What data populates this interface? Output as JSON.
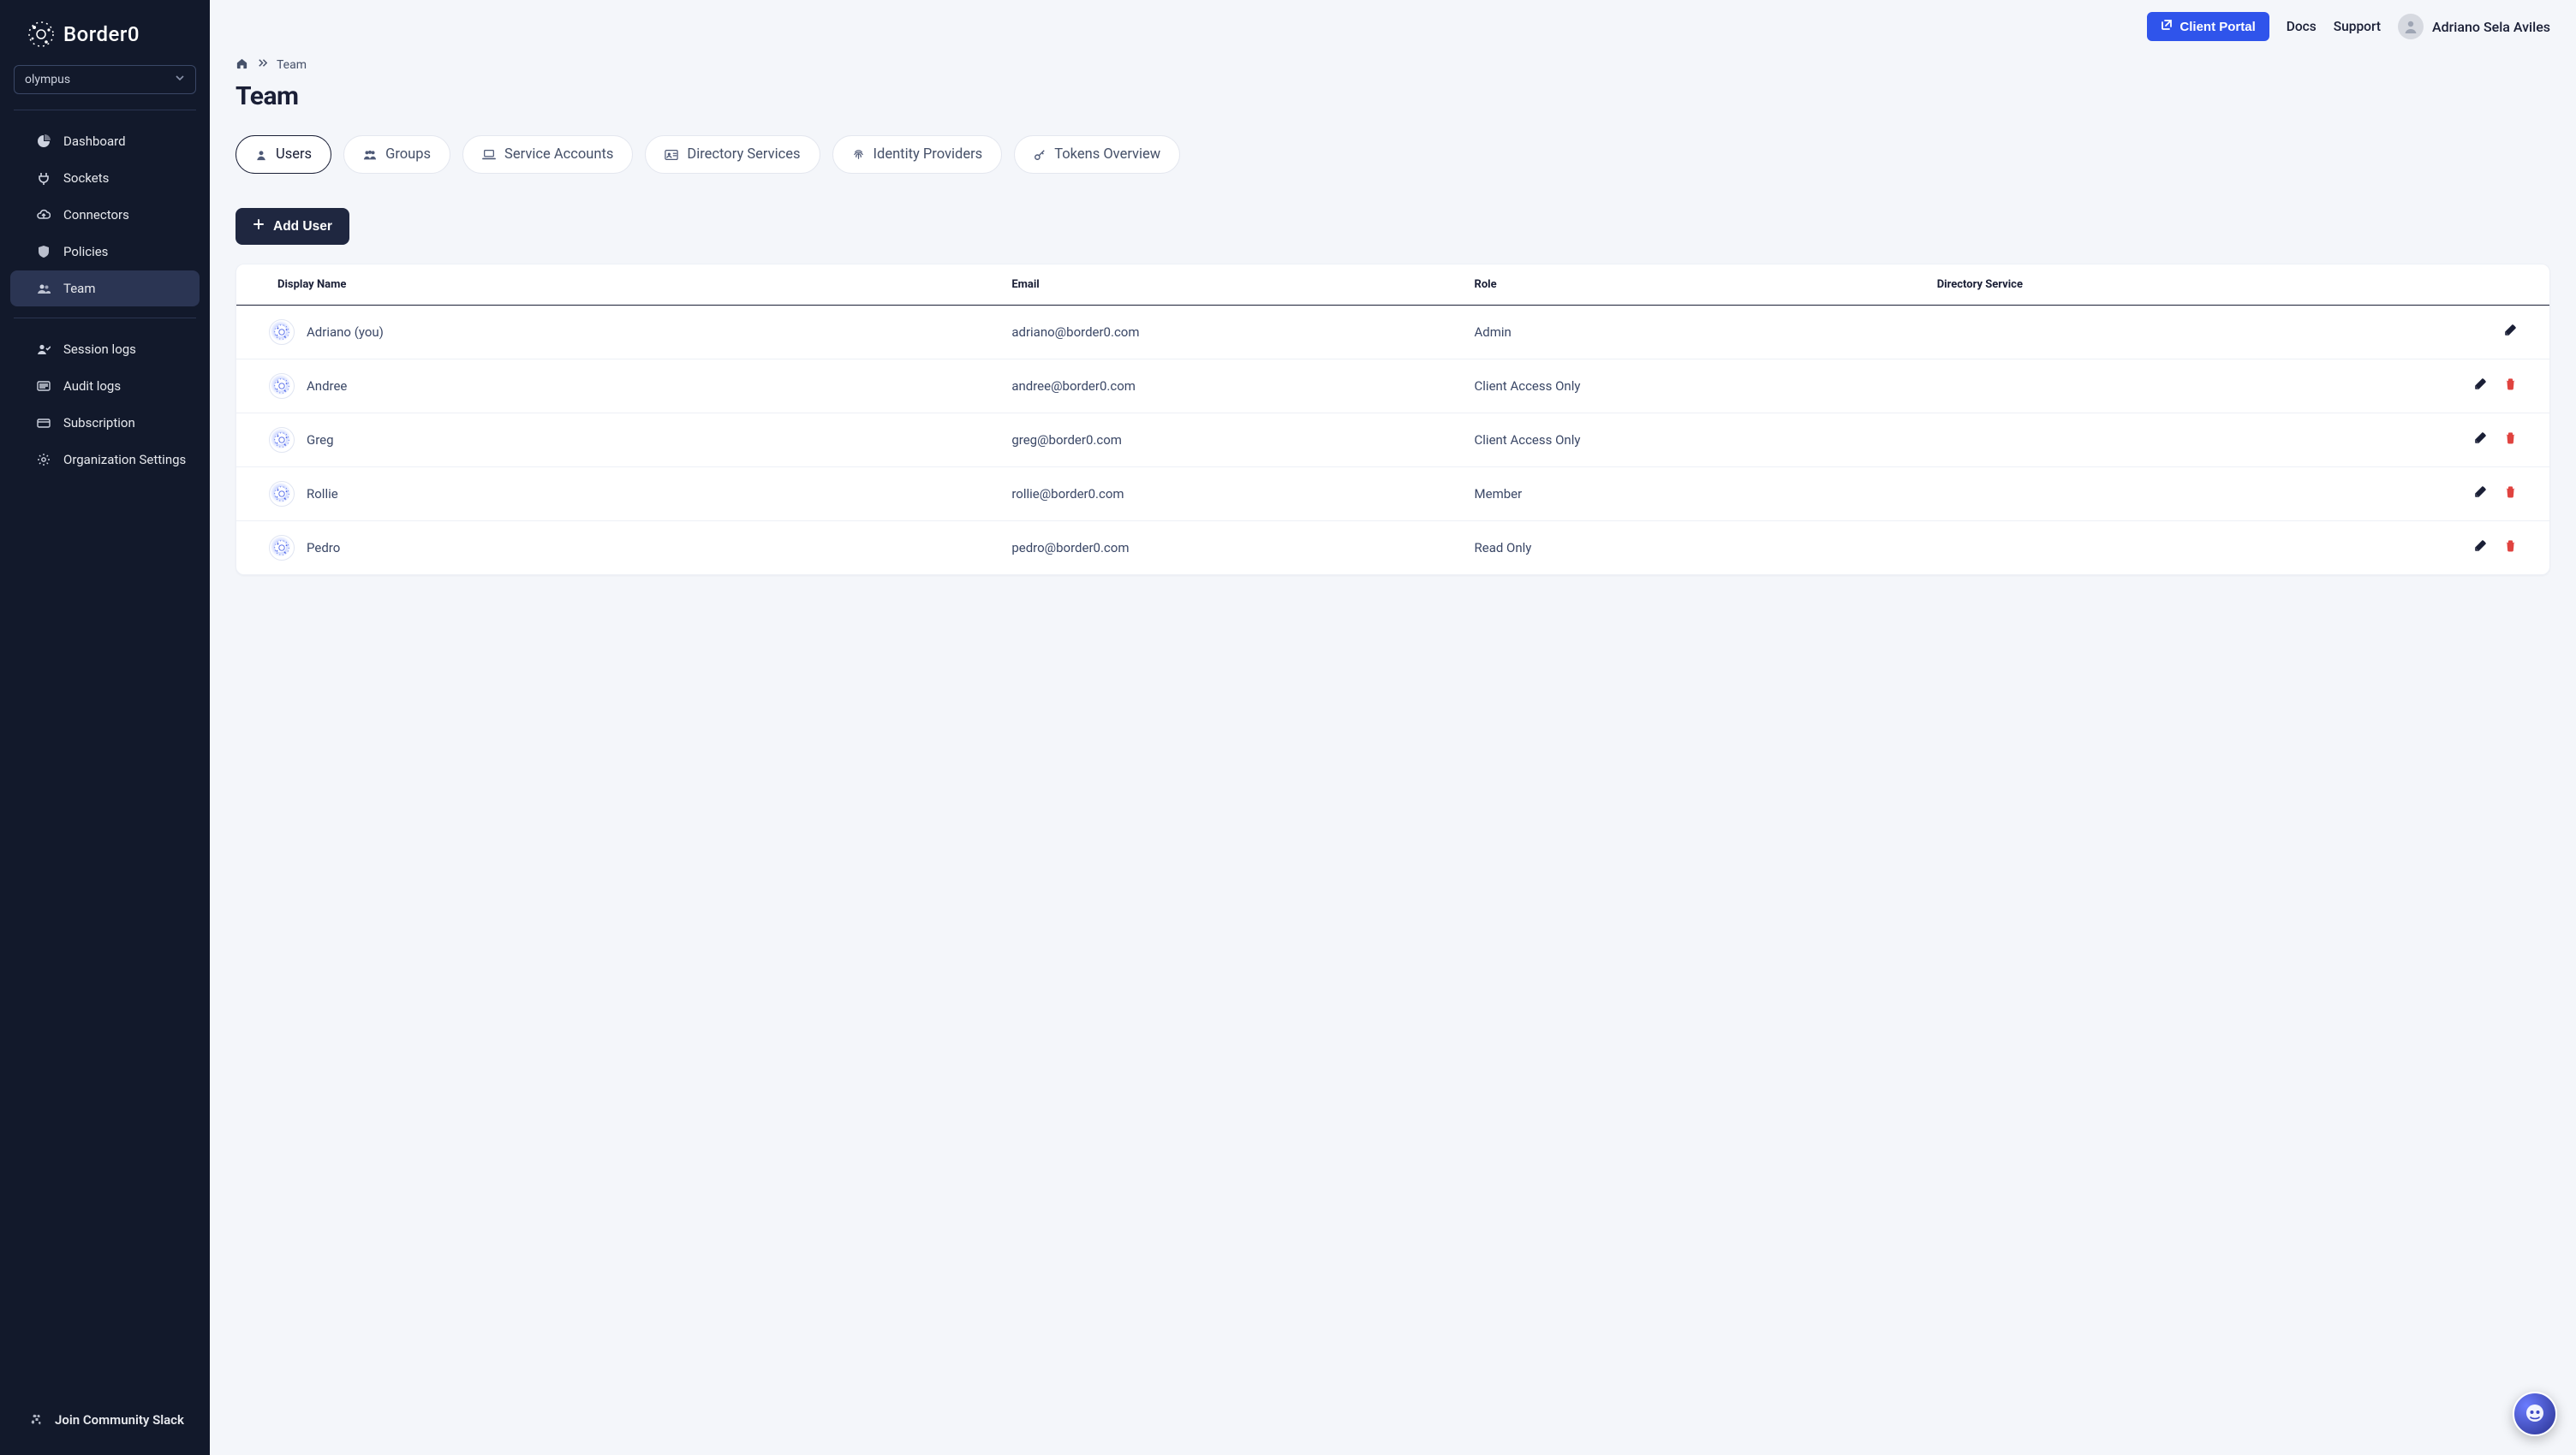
{
  "brand": {
    "name": "Border0"
  },
  "org_selector": {
    "value": "olympus"
  },
  "sidebar": {
    "items": [
      {
        "label": "Dashboard",
        "icon": "pie-chart-icon",
        "active": false
      },
      {
        "label": "Sockets",
        "icon": "plug-icon",
        "active": false
      },
      {
        "label": "Connectors",
        "icon": "cloud-up-icon",
        "active": false
      },
      {
        "label": "Policies",
        "icon": "shield-icon",
        "active": false
      },
      {
        "label": "Team",
        "icon": "users-icon",
        "active": true
      }
    ],
    "items2": [
      {
        "label": "Session logs",
        "icon": "user-check-icon"
      },
      {
        "label": "Audit logs",
        "icon": "list-icon"
      },
      {
        "label": "Subscription",
        "icon": "card-icon"
      },
      {
        "label": "Organization Settings",
        "icon": "gear-icon"
      }
    ],
    "footer": {
      "label": "Join Community Slack",
      "icon": "slack-icon"
    }
  },
  "topbar": {
    "client_portal": "Client Portal",
    "docs": "Docs",
    "support": "Support",
    "user_name": "Adriano Sela Aviles"
  },
  "breadcrumb": {
    "home": "home",
    "current": "Team"
  },
  "page": {
    "title": "Team"
  },
  "tabs": [
    {
      "label": "Users",
      "icon": "user-icon",
      "active": true
    },
    {
      "label": "Groups",
      "icon": "group-icon",
      "active": false
    },
    {
      "label": "Service Accounts",
      "icon": "laptop-icon",
      "active": false
    },
    {
      "label": "Directory Services",
      "icon": "id-card-icon",
      "active": false
    },
    {
      "label": "Identity Providers",
      "icon": "fingerprint-icon",
      "active": false
    },
    {
      "label": "Tokens Overview",
      "icon": "key-icon",
      "active": false
    }
  ],
  "actions": {
    "add_user": "Add User"
  },
  "table": {
    "columns": {
      "display_name": "Display Name",
      "email": "Email",
      "role": "Role",
      "directory_service": "Directory Service"
    },
    "rows": [
      {
        "name": "Adriano (you)",
        "email": "adriano@border0.com",
        "role": "Admin",
        "deletable": false
      },
      {
        "name": "Andree",
        "email": "andree@border0.com",
        "role": "Client Access Only",
        "deletable": true
      },
      {
        "name": "Greg",
        "email": "greg@border0.com",
        "role": "Client Access Only",
        "deletable": true
      },
      {
        "name": "Rollie",
        "email": "rollie@border0.com",
        "role": "Member",
        "deletable": true
      },
      {
        "name": "Pedro",
        "email": "pedro@border0.com",
        "role": "Read Only",
        "deletable": true
      }
    ]
  }
}
